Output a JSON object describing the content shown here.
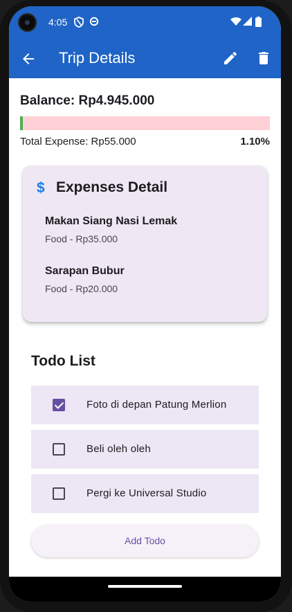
{
  "status_bar": {
    "time": "4:05",
    "icons": [
      "shield-icon",
      "sync-icon",
      "wifi-icon",
      "signal-icon",
      "battery-icon"
    ]
  },
  "app_bar": {
    "title": "Trip Details",
    "back_icon": "arrow-back-icon",
    "edit_icon": "edit-icon",
    "delete_icon": "delete-icon",
    "color": "#1f64c6"
  },
  "summary": {
    "balance_label": "Balance: Rp4.945.000",
    "expense_progress": 0.011,
    "total_expense_label": "Total Expense: Rp55.000",
    "percent_label": "1.10%",
    "progress_track_color": "#ffd1d6",
    "progress_fill_color": "#4caf50"
  },
  "expenses_card": {
    "icon": "dollar-icon",
    "title": "Expenses Detail",
    "items": [
      {
        "name": "Makan Siang Nasi Lemak",
        "detail": "Food - Rp35.000"
      },
      {
        "name": "Sarapan Bubur",
        "detail": "Food - Rp20.000"
      }
    ]
  },
  "todo": {
    "title": "Todo List",
    "items": [
      {
        "label": "Foto di depan Patung Merlion",
        "checked": true
      },
      {
        "label": "Beli oleh oleh",
        "checked": false
      },
      {
        "label": "Pergi ke Universal Studio",
        "checked": false
      }
    ],
    "add_button_label": "Add Todo"
  }
}
